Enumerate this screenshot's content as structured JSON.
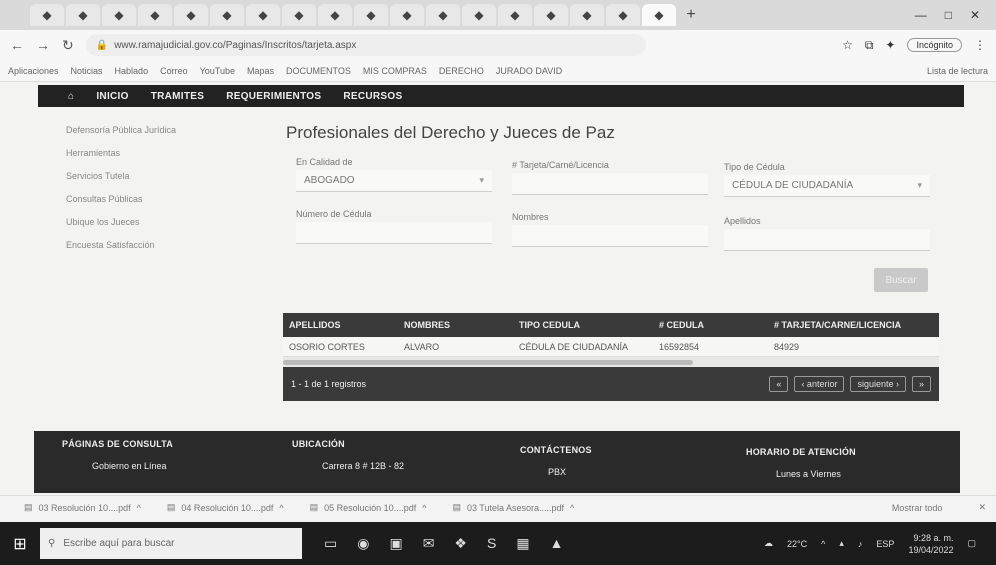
{
  "browser": {
    "url": "www.ramajudicial.gov.co/Paginas/Inscritos/tarjeta.aspx",
    "profile": "Incógnito",
    "bookmarks": [
      "Aplicaciones",
      "Noticias",
      "Hablado",
      "Correo",
      "YouTube",
      "Mapas",
      "DOCUMENTOS",
      "MIS COMPRAS",
      "DERECHO",
      "JURADO DAVID"
    ],
    "bookmarks_right": "Lista de lectura"
  },
  "nav": [
    "INICIO",
    "TRAMITES",
    "REQUERIMIENTOS",
    "RECURSOS"
  ],
  "sidebar": [
    "Defensoría Pública Jurídica",
    "Herramientas",
    "Servicios Tutela",
    "Consultas Públicas",
    "Ubique los Jueces",
    "Encuesta Satisfacción"
  ],
  "page_title": "Profesionales del Derecho y Jueces de Paz",
  "form": {
    "calidad_label": "En Calidad de",
    "calidad_value": "ABOGADO",
    "tarjeta_label": "# Tarjeta/Carné/Licencia",
    "tarjeta_value": "",
    "tipo_label": "Tipo de Cédula",
    "tipo_value": "CÉDULA DE CIUDADANÍA",
    "cedula_label": "Número de Cédula",
    "cedula_value": "",
    "nombres_label": "Nombres",
    "nombres_value": "",
    "apellidos_label": "Apellidos",
    "apellidos_value": "",
    "search_button": "Buscar"
  },
  "table": {
    "headers": [
      "APELLIDOS",
      "NOMBRES",
      "TIPO CEDULA",
      "# CEDULA",
      "# TARJETA/CARNE/LICENCIA"
    ],
    "rows": [
      [
        "OSORIO CORTES",
        "ALVARO",
        "CÉDULA DE CIUDADANÍA",
        "16592854",
        "84929"
      ]
    ],
    "pager_info": "1 - 1 de 1 registros",
    "pager_buttons": [
      "«",
      "‹ anterior",
      "siguiente ›",
      "»"
    ]
  },
  "footer": {
    "col1_h": "PÁGINAS DE CONSULTA",
    "col1_v": "Gobierno en Línea",
    "col2_h": "UBICACIÓN",
    "col2_v": "Carrera 8 # 12B - 82",
    "col3_h": "CONTÁCTENOS",
    "col3_v": "PBX",
    "col4_h": "HORARIO DE ATENCIÓN",
    "col4_v": "Lunes a Viernes"
  },
  "downloads": [
    "03 Resolución 10....pdf",
    "04 Resolución 10....pdf",
    "05 Resolución 10....pdf",
    "03 Tutela Asesora.....pdf"
  ],
  "downloads_show_all": "Mostrar todo",
  "taskbar": {
    "search_placeholder": "Escribe aquí para buscar",
    "weather": "22°C",
    "lang": "ESP",
    "time": "9:28 a. m.",
    "date": "19/04/2022"
  }
}
